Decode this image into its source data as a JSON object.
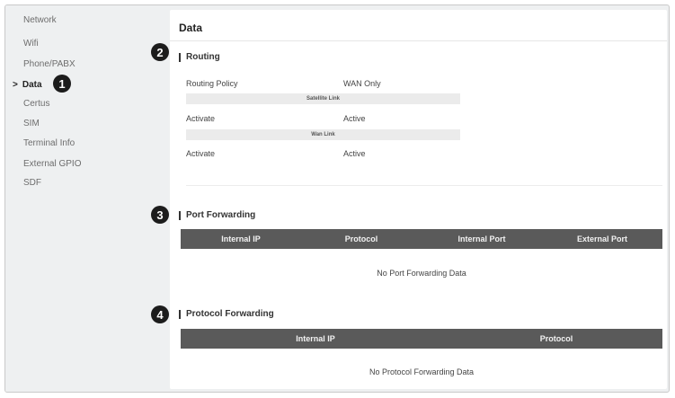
{
  "sidebar": {
    "items": [
      {
        "label": "Network"
      },
      {
        "label": "Wifi"
      },
      {
        "label": "Phone/PABX"
      },
      {
        "label": "Data",
        "active": true
      },
      {
        "label": "Certus"
      },
      {
        "label": "SIM"
      },
      {
        "label": "Terminal Info"
      },
      {
        "label": "External GPIO"
      },
      {
        "label": "SDF"
      }
    ],
    "active_chevron": ">"
  },
  "callouts": [
    "1",
    "2",
    "3",
    "4"
  ],
  "main": {
    "title": "Data",
    "routing": {
      "title": "Routing",
      "policy_label": "Routing Policy",
      "policy_value": "WAN Only",
      "satellite_header": "Satellite Link",
      "satellite_activate_label": "Activate",
      "satellite_activate_value": "Active",
      "wan_header": "Wan Link",
      "wan_activate_label": "Activate",
      "wan_activate_value": "Active"
    },
    "port_forwarding": {
      "title": "Port Forwarding",
      "columns": [
        "Internal IP",
        "Protocol",
        "Internal Port",
        "External Port"
      ],
      "empty_text": "No Port Forwarding Data"
    },
    "protocol_forwarding": {
      "title": "Protocol Forwarding",
      "columns": [
        "Internal IP",
        "Protocol"
      ],
      "empty_text": "No Protocol Forwarding Data"
    }
  },
  "colors": {
    "sidebar_bg": "#eef0f1",
    "table_header_bg": "#5a5a5a",
    "badge_bg": "#1c1c1c"
  }
}
